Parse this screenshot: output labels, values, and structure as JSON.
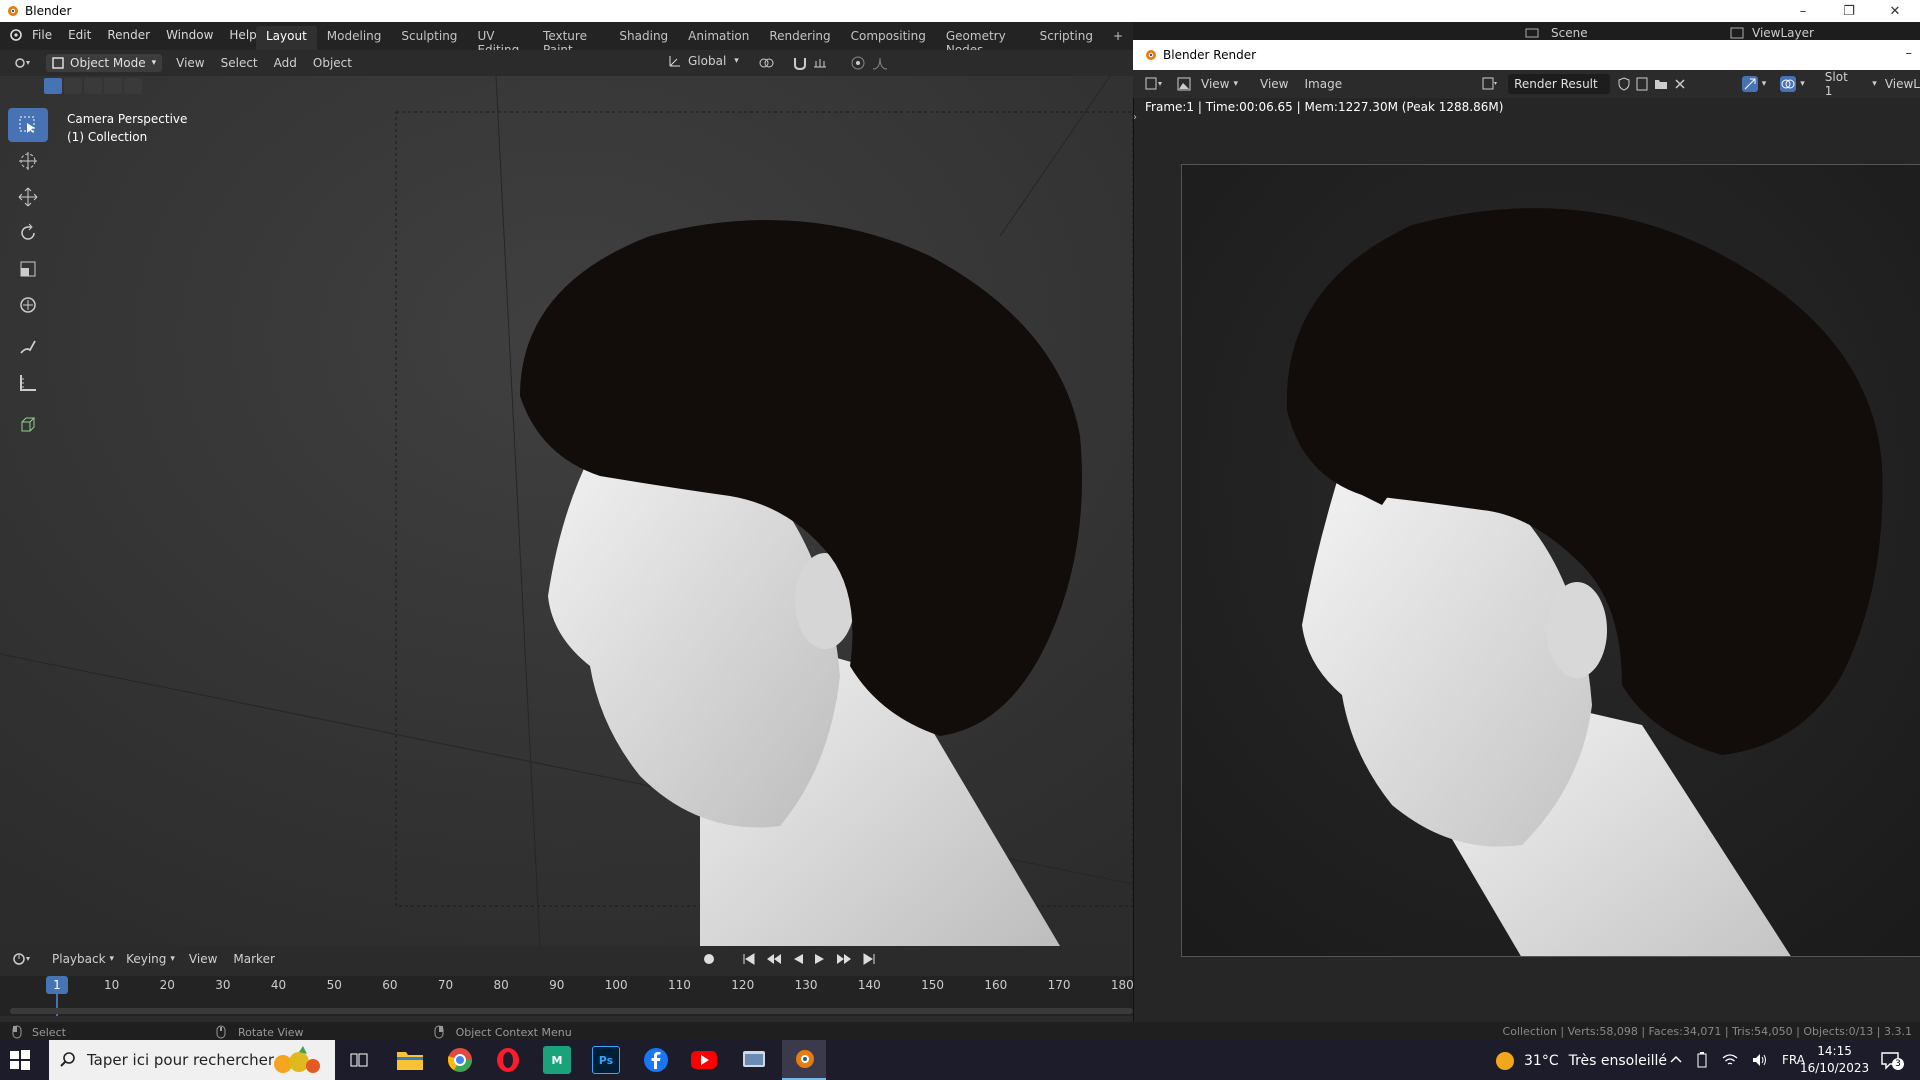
{
  "window": {
    "title": "Blender",
    "controls": [
      "–",
      "❐",
      "✕"
    ]
  },
  "menu": {
    "items": [
      "File",
      "Edit",
      "Render",
      "Window",
      "Help"
    ]
  },
  "workspaces": [
    "Layout",
    "Modeling",
    "Sculpting",
    "UV Editing",
    "Texture Paint",
    "Shading",
    "Animation",
    "Rendering",
    "Compositing",
    "Geometry Nodes",
    "Scripting"
  ],
  "active_workspace": "Layout",
  "scene": {
    "label": "Scene",
    "view_layer": "ViewLayer"
  },
  "viewport_header": {
    "mode": "Object Mode",
    "menus": [
      "View",
      "Select",
      "Add",
      "Object"
    ],
    "orientation": "Global"
  },
  "viewport": {
    "overlay_line1": "Camera Perspective",
    "overlay_line2": "(1) Collection"
  },
  "tools": [
    "select-box-icon",
    "cursor-icon",
    "move-icon",
    "rotate-icon",
    "scale-icon",
    "transform-icon",
    "annotate-icon",
    "measure-icon",
    "add-cube-icon"
  ],
  "timeline": {
    "menus": [
      "Playback",
      "Keying",
      "View",
      "Marker"
    ],
    "current_frame": "1",
    "frame_labels": [
      "10",
      "20",
      "30",
      "40",
      "50",
      "60",
      "70",
      "80",
      "90",
      "100",
      "110",
      "120",
      "130",
      "140",
      "150",
      "160",
      "170",
      "180"
    ]
  },
  "statusbar": {
    "left": "Select",
    "middle": "Rotate View",
    "right": "Object Context Menu",
    "stats": "Collection | Verts:58,098 | Faces:34,071 | Tris:54,050 | Objects:0/13 | 3.3.1"
  },
  "render_window": {
    "title": "Blender Render",
    "menus": [
      "View",
      "View",
      "Image"
    ],
    "image_name": "Render Result",
    "slot": "Slot 1",
    "view_layer_short": "ViewL",
    "info": "Frame:1 | Time:00:06.65 | Mem:1227.30M (Peak 1288.86M)"
  },
  "taskbar": {
    "search_placeholder": "Taper ici pour rechercher",
    "weather_temp": "31°C",
    "weather_text": "Très ensoleillé",
    "language": "FRA",
    "time": "14:15",
    "date": "16/10/2023",
    "notifications": "3",
    "app_ps": "Ps",
    "app_m": "M"
  },
  "colors": {
    "accent": "#4772b3",
    "hair": "#120c0a",
    "skin": "#e4e4e4"
  }
}
